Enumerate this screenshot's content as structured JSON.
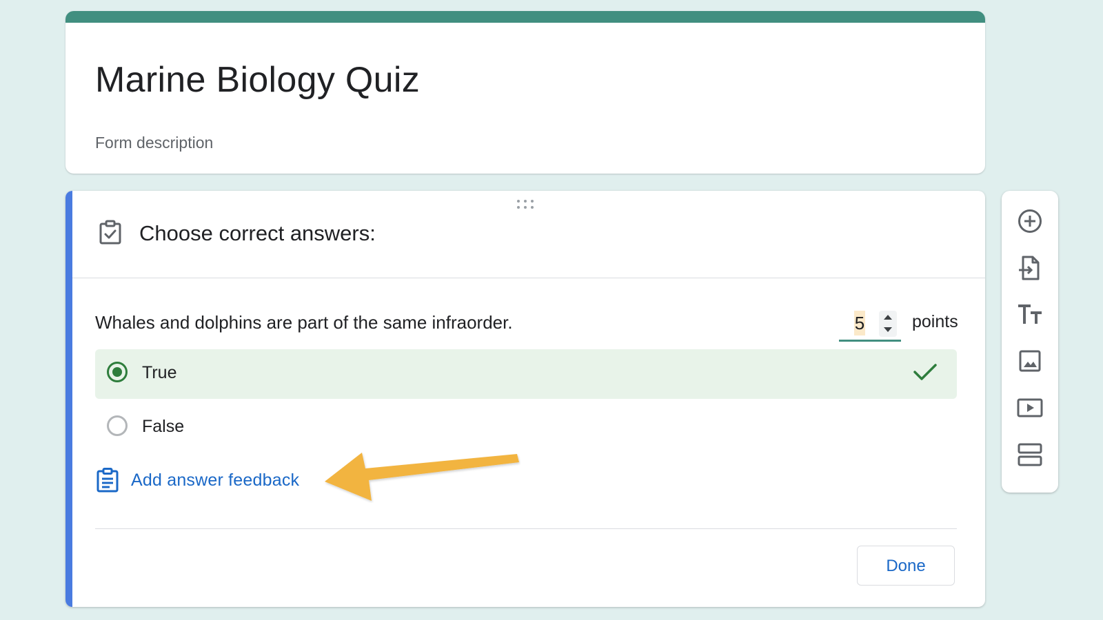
{
  "form": {
    "title": "Marine Biology Quiz",
    "description_placeholder": "Form description"
  },
  "answer_key": {
    "title": "Choose correct answers:"
  },
  "question": {
    "text": "Whales and dolphins are part of the same infraorder.",
    "points_value": "5",
    "points_label": "points",
    "options": [
      {
        "label": "True",
        "selected": true,
        "correct": true
      },
      {
        "label": "False",
        "selected": false,
        "correct": false
      }
    ],
    "feedback_link": "Add answer feedback",
    "done_label": "Done"
  },
  "toolbar": {
    "items": [
      "add-question-icon",
      "import-questions-icon",
      "add-title-icon",
      "add-image-icon",
      "add-video-icon",
      "add-section-icon"
    ]
  },
  "colors": {
    "page_bg": "#e0efee",
    "header_band": "#418f80",
    "card_accent": "#4a7be0",
    "correct_green": "#2e7d3c",
    "link_blue": "#1a68c7",
    "arrow_orange": "#f2b43f"
  }
}
